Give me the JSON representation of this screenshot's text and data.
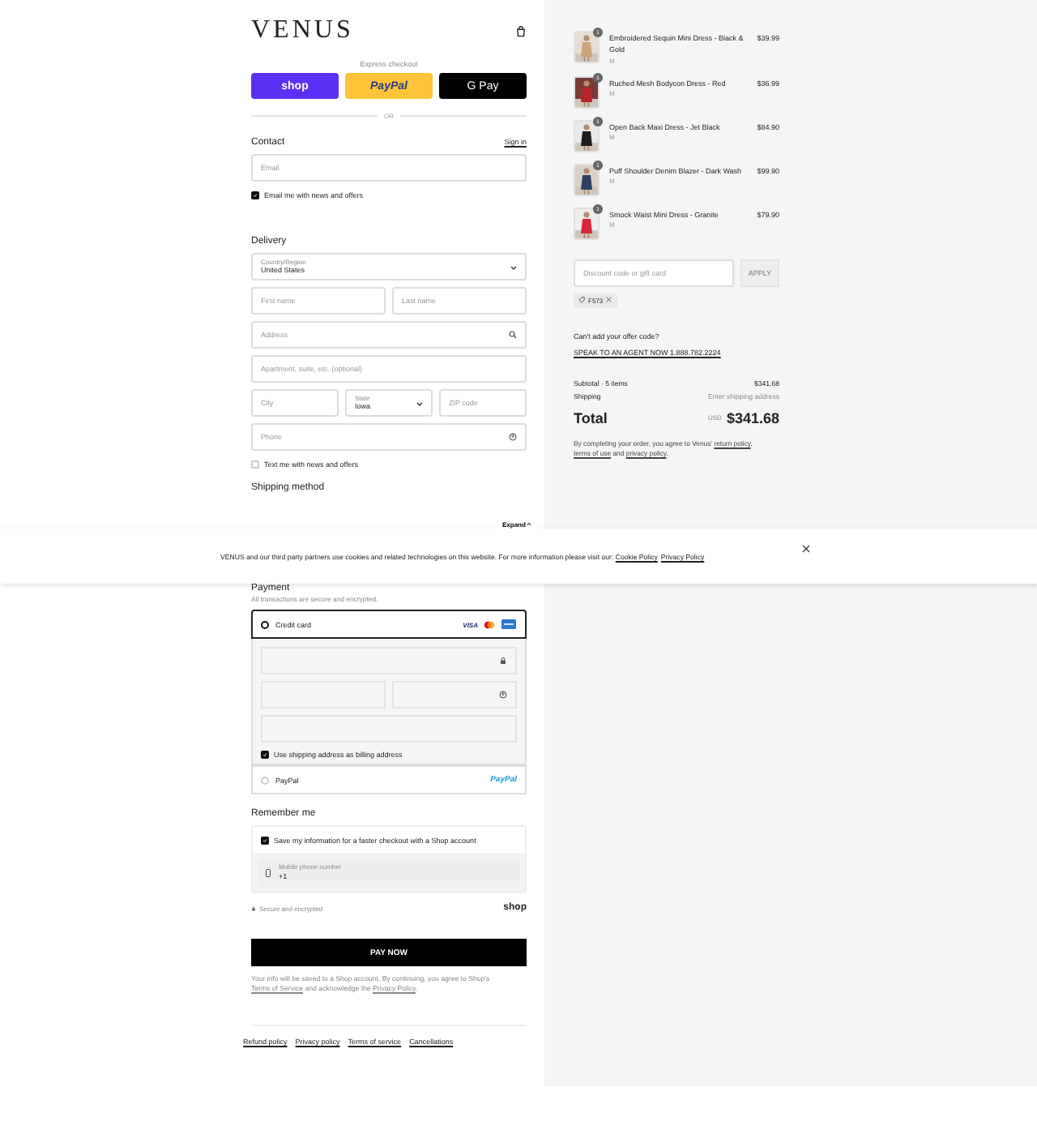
{
  "header": {
    "logo": "VENUS"
  },
  "express_checkout": {
    "label": "Express checkout",
    "buttons": [
      {
        "kind": "shop",
        "label": "shop"
      },
      {
        "kind": "paypal",
        "label": "PayPal"
      },
      {
        "kind": "gpay",
        "label": "G Pay"
      }
    ],
    "divider": "OR"
  },
  "contact": {
    "title": "Contact",
    "sign_in": "Sign in",
    "email_placeholder": "Email",
    "news_checkbox": {
      "label": "Email me with news and offers",
      "checked": true
    }
  },
  "delivery": {
    "title": "Delivery",
    "country": {
      "label": "Country/Region",
      "value": "United States"
    },
    "first_name_placeholder": "First name",
    "last_name_placeholder": "Last name",
    "address_placeholder": "Address",
    "apartment_placeholder": "Apartment, suite, etc. (optional)",
    "city_placeholder": "City",
    "state": {
      "label": "State",
      "value": "Iowa"
    },
    "zip_placeholder": "ZIP code",
    "phone_placeholder": "Phone",
    "text_checkbox": {
      "label": "Text me with news and offers",
      "checked": false
    }
  },
  "shipping_method": {
    "title": "Shipping method"
  },
  "summary_toggle": {
    "label": "Expand"
  },
  "cookie_banner": {
    "text": "VENUS and our third party partners use cookies and related technologies on this website. For more information please visit our:",
    "links": [
      "Cookie Policy",
      "Privacy Policy"
    ]
  },
  "payment": {
    "title": "Payment",
    "subtitle": "All transactions are secure and encrypted.",
    "methods": [
      {
        "kind": "card",
        "label": "Credit card",
        "selected": true
      },
      {
        "kind": "paypal",
        "label": "PayPal",
        "selected": false
      }
    ],
    "card_brands": [
      {
        "kind": "visa",
        "label": "VISA"
      },
      {
        "kind": "mastercard"
      },
      {
        "kind": "amex"
      }
    ],
    "billing_checkbox": {
      "label": "Use shipping address as billing address",
      "checked": true
    },
    "paypal_logo": "PayPal"
  },
  "remember_me": {
    "title": "Remember me",
    "save_checkbox": {
      "label": "Save my information for a faster checkout with a Shop account",
      "checked": true
    },
    "phone": {
      "label": "Mobile phone number",
      "value": "+1"
    },
    "secure_note": "Secure and encrypted",
    "shop_logo": "shop"
  },
  "pay_button": "PAY NOW",
  "shop_notice": [
    {
      "kind": "text",
      "text": "Your info will be saved to a Shop account. By continuing, you agree to Shop's "
    },
    {
      "kind": "link",
      "text": "Terms of Service"
    },
    {
      "kind": "text",
      "text": " and acknowledge the "
    },
    {
      "kind": "link",
      "text": "Privacy Policy"
    },
    {
      "kind": "text",
      "text": "."
    }
  ],
  "footer_links": [
    "Refund policy",
    "Privacy policy",
    "Terms of service",
    "Cancellations"
  ],
  "order_summary": {
    "items": [
      {
        "name": "Embroidered Sequin Mini Dress - Black & Gold",
        "variant": "M",
        "price": "$39.99",
        "quantity": "1"
      },
      {
        "name": "Ruched Mesh Bodycon Dress - Red",
        "variant": "M",
        "price": "$36.99",
        "quantity": "1"
      },
      {
        "name": "Open Back Maxi Dress - Jet Black",
        "variant": "M",
        "price": "$84.90",
        "quantity": "1"
      },
      {
        "name": "Puff Shoulder Denim Blazer - Dark Wash",
        "variant": "M",
        "price": "$99.90",
        "quantity": "1"
      },
      {
        "name": "Smock Waist Mini Dress - Granite",
        "variant": "M",
        "price": "$79.90",
        "quantity": "1"
      }
    ],
    "discount_placeholder": "Discount code or gift card",
    "apply_button": "APPLY",
    "applied_code": "F573",
    "offer_question": "Can't add your offer code?",
    "agent_link": "SPEAK TO AN AGENT NOW 1.888.782.2224",
    "subtotal_label": "Subtotal · 5 items",
    "subtotal_value": "$341.68",
    "shipping_label": "Shipping",
    "shipping_value": "Enter shipping address",
    "total_label": "Total",
    "currency": "USD",
    "total_value": "$341.68",
    "terms": [
      {
        "kind": "text",
        "text": "By completing your order, you agree to Venus' "
      },
      {
        "kind": "link",
        "text": "return policy"
      },
      {
        "kind": "text",
        "text": ", "
      },
      {
        "kind": "link",
        "text": "terms of use"
      },
      {
        "kind": "text",
        "text": " and "
      },
      {
        "kind": "link",
        "text": "privacy policy"
      },
      {
        "kind": "text",
        "text": "."
      }
    ]
  }
}
